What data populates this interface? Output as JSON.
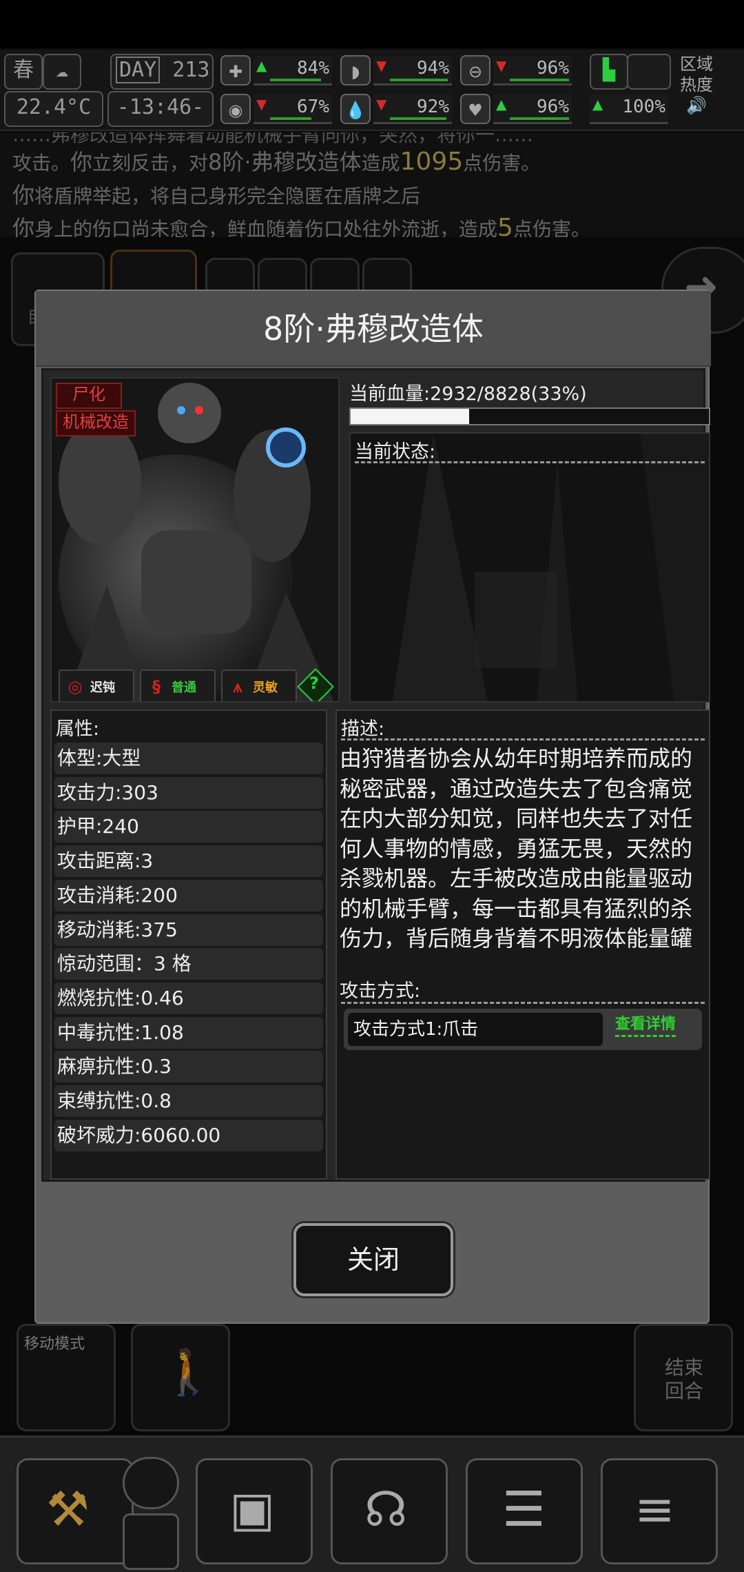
{
  "hud": {
    "season": "春",
    "weather_icon": "cloud-rain-icon",
    "day_label": "DAY",
    "day_number": "213",
    "temperature": "22.4°C",
    "time": "-13:46-",
    "stats": [
      {
        "icon": "medkit-icon",
        "trend": "up",
        "value": "84%",
        "level": 0.84
      },
      {
        "icon": "stomach-icon",
        "trend": "down",
        "value": "94%",
        "level": 0.94
      },
      {
        "icon": "capsule-icon",
        "trend": "down",
        "value": "96%",
        "level": 0.96
      },
      {
        "icon": "eye-icon",
        "trend": "down",
        "value": "67%",
        "level": 0.67
      },
      {
        "icon": "water-drop-icon",
        "trend": "down",
        "value": "92%",
        "level": 0.92
      },
      {
        "icon": "heart-icon",
        "trend": "up",
        "value": "96%",
        "level": 0.96
      }
    ],
    "boot_stat": {
      "icon": "boot-icon",
      "trend": "up",
      "value": "100%"
    },
    "zone_heat_line1": "区域",
    "zone_heat_line2": "热度"
  },
  "log": {
    "line0": "……弗穆改造体挥舞着动能机械手臂向你，突然，将你一……",
    "line1_a": "攻击。",
    "line1_b": "你",
    "line1_c": "立刻反击，对",
    "line1_d": "8阶·弗穆改造体",
    "line1_e": "造成",
    "line1_f": "1095",
    "line1_g": "点伤害。",
    "line2_a": "你",
    "line2_b": "将盾牌举起，将自己身形完全隐匿在盾牌之后",
    "line3_a": "你",
    "line3_b": "身上的伤口尚未愈合，鲜血随着伤口处往外流逝，造成",
    "line3_c": "5",
    "line3_d": "点伤害。"
  },
  "background": {
    "auto_label": "自动",
    "move_mode_label": "移动模式",
    "end_turn_label": "结束回合"
  },
  "dialog": {
    "title": "8阶·弗穆改造体",
    "tags": [
      "尸化",
      "机械改造"
    ],
    "senses": [
      {
        "icon": "eye-sense-icon",
        "label": "迟钝",
        "color": "#e8e8e8"
      },
      {
        "icon": "ear-sense-icon",
        "label": "普通",
        "color": "#3ac83a"
      },
      {
        "icon": "nose-sense-icon",
        "label": "灵敏",
        "color": "#e8a020"
      }
    ],
    "help_icon": "question-icon",
    "hp_label": "当前血量:2932/8828(33%)",
    "hp_fraction": 0.33,
    "status_header": "当前状态:",
    "attributes_header": "属性:",
    "attributes": [
      "体型:大型",
      "攻击力:303",
      "护甲:240",
      "攻击距离:3",
      "攻击消耗:200",
      "移动消耗:375",
      "惊动范围：3 格",
      "燃烧抗性:0.46",
      "中毒抗性:1.08",
      "麻痹抗性:0.3",
      "束缚抗性:0.8",
      "破坏威力:6060.00"
    ],
    "description_header": "描述:",
    "description": "由狩猎者协会从幼年时期培养而成的秘密武器，通过改造失去了包含痛觉在内大部分知觉，同样也失去了对任何人事物的情感，勇猛无畏，天然的杀戮机器。左手被改造成由能量驱动的机械手臂，每一击都具有猛烈的杀伤力，背后随身背着不明液体能量罐",
    "attack_header": "攻击方式:",
    "attacks": [
      {
        "name": "攻击方式1:爪击",
        "detail_label": "查看详情"
      }
    ],
    "close_label": "关闭"
  },
  "toolbar": {
    "items": [
      {
        "icon": "hammer-icon"
      },
      {
        "icon": "backpack-icon"
      },
      {
        "icon": "brain-icon"
      },
      {
        "icon": "journal-icon"
      },
      {
        "icon": "menu-icon"
      }
    ]
  }
}
